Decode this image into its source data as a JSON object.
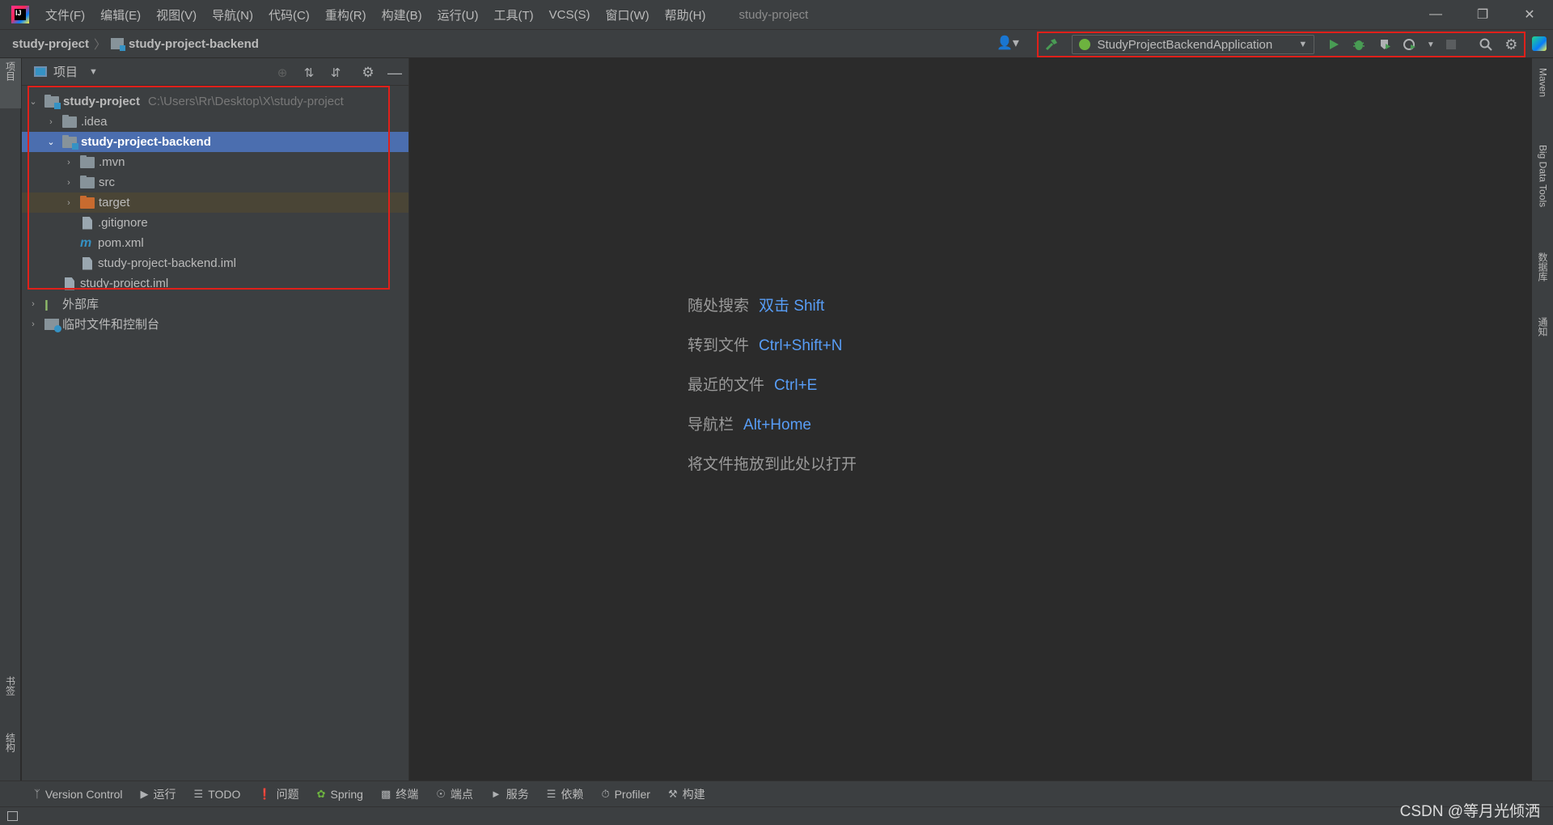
{
  "titlebar": {
    "menu": [
      "文件(F)",
      "编辑(E)",
      "视图(V)",
      "导航(N)",
      "代码(C)",
      "重构(R)",
      "构建(B)",
      "运行(U)",
      "工具(T)",
      "VCS(S)",
      "窗口(W)",
      "帮助(H)"
    ],
    "title": "study-project",
    "minimize": "—",
    "restore": "❐",
    "close": "✕"
  },
  "navbar": {
    "crumbs": [
      "study-project",
      "study-project-backend"
    ],
    "run_config": "StudyProjectBackendApplication"
  },
  "left_stripe": {
    "project_tab": "项目",
    "bookmarks_tab": "书签",
    "structure_tab": "结构"
  },
  "right_stripe": {
    "maven_tab": "Maven",
    "bigdata_tab": "Big Data Tools",
    "database_tab": "数据库",
    "notifications_tab": "通知"
  },
  "project_panel": {
    "title": "项目",
    "tree": [
      {
        "label": "study-project",
        "path": "C:\\Users\\Rr\\Desktop\\X\\study-project"
      },
      {
        "label": ".idea"
      },
      {
        "label": "study-project-backend"
      },
      {
        "label": ".mvn"
      },
      {
        "label": "src"
      },
      {
        "label": "target"
      },
      {
        "label": ".gitignore"
      },
      {
        "label": "pom.xml"
      },
      {
        "label": "study-project-backend.iml"
      },
      {
        "label": "study-project.iml"
      },
      {
        "label": "外部库"
      },
      {
        "label": "临时文件和控制台"
      }
    ]
  },
  "editor_hints": [
    {
      "label": "随处搜索",
      "key": "双击 Shift"
    },
    {
      "label": "转到文件",
      "key": "Ctrl+Shift+N"
    },
    {
      "label": "最近的文件",
      "key": "Ctrl+E"
    },
    {
      "label": "导航栏",
      "key": "Alt+Home"
    },
    {
      "label": "将文件拖放到此处以打开",
      "key": ""
    }
  ],
  "bottom_tabs": [
    "Version Control",
    "运行",
    "TODO",
    "问题",
    "Spring",
    "终端",
    "端点",
    "服务",
    "依赖",
    "Profiler",
    "构建"
  ],
  "watermark": "CSDN @等月光倾洒"
}
